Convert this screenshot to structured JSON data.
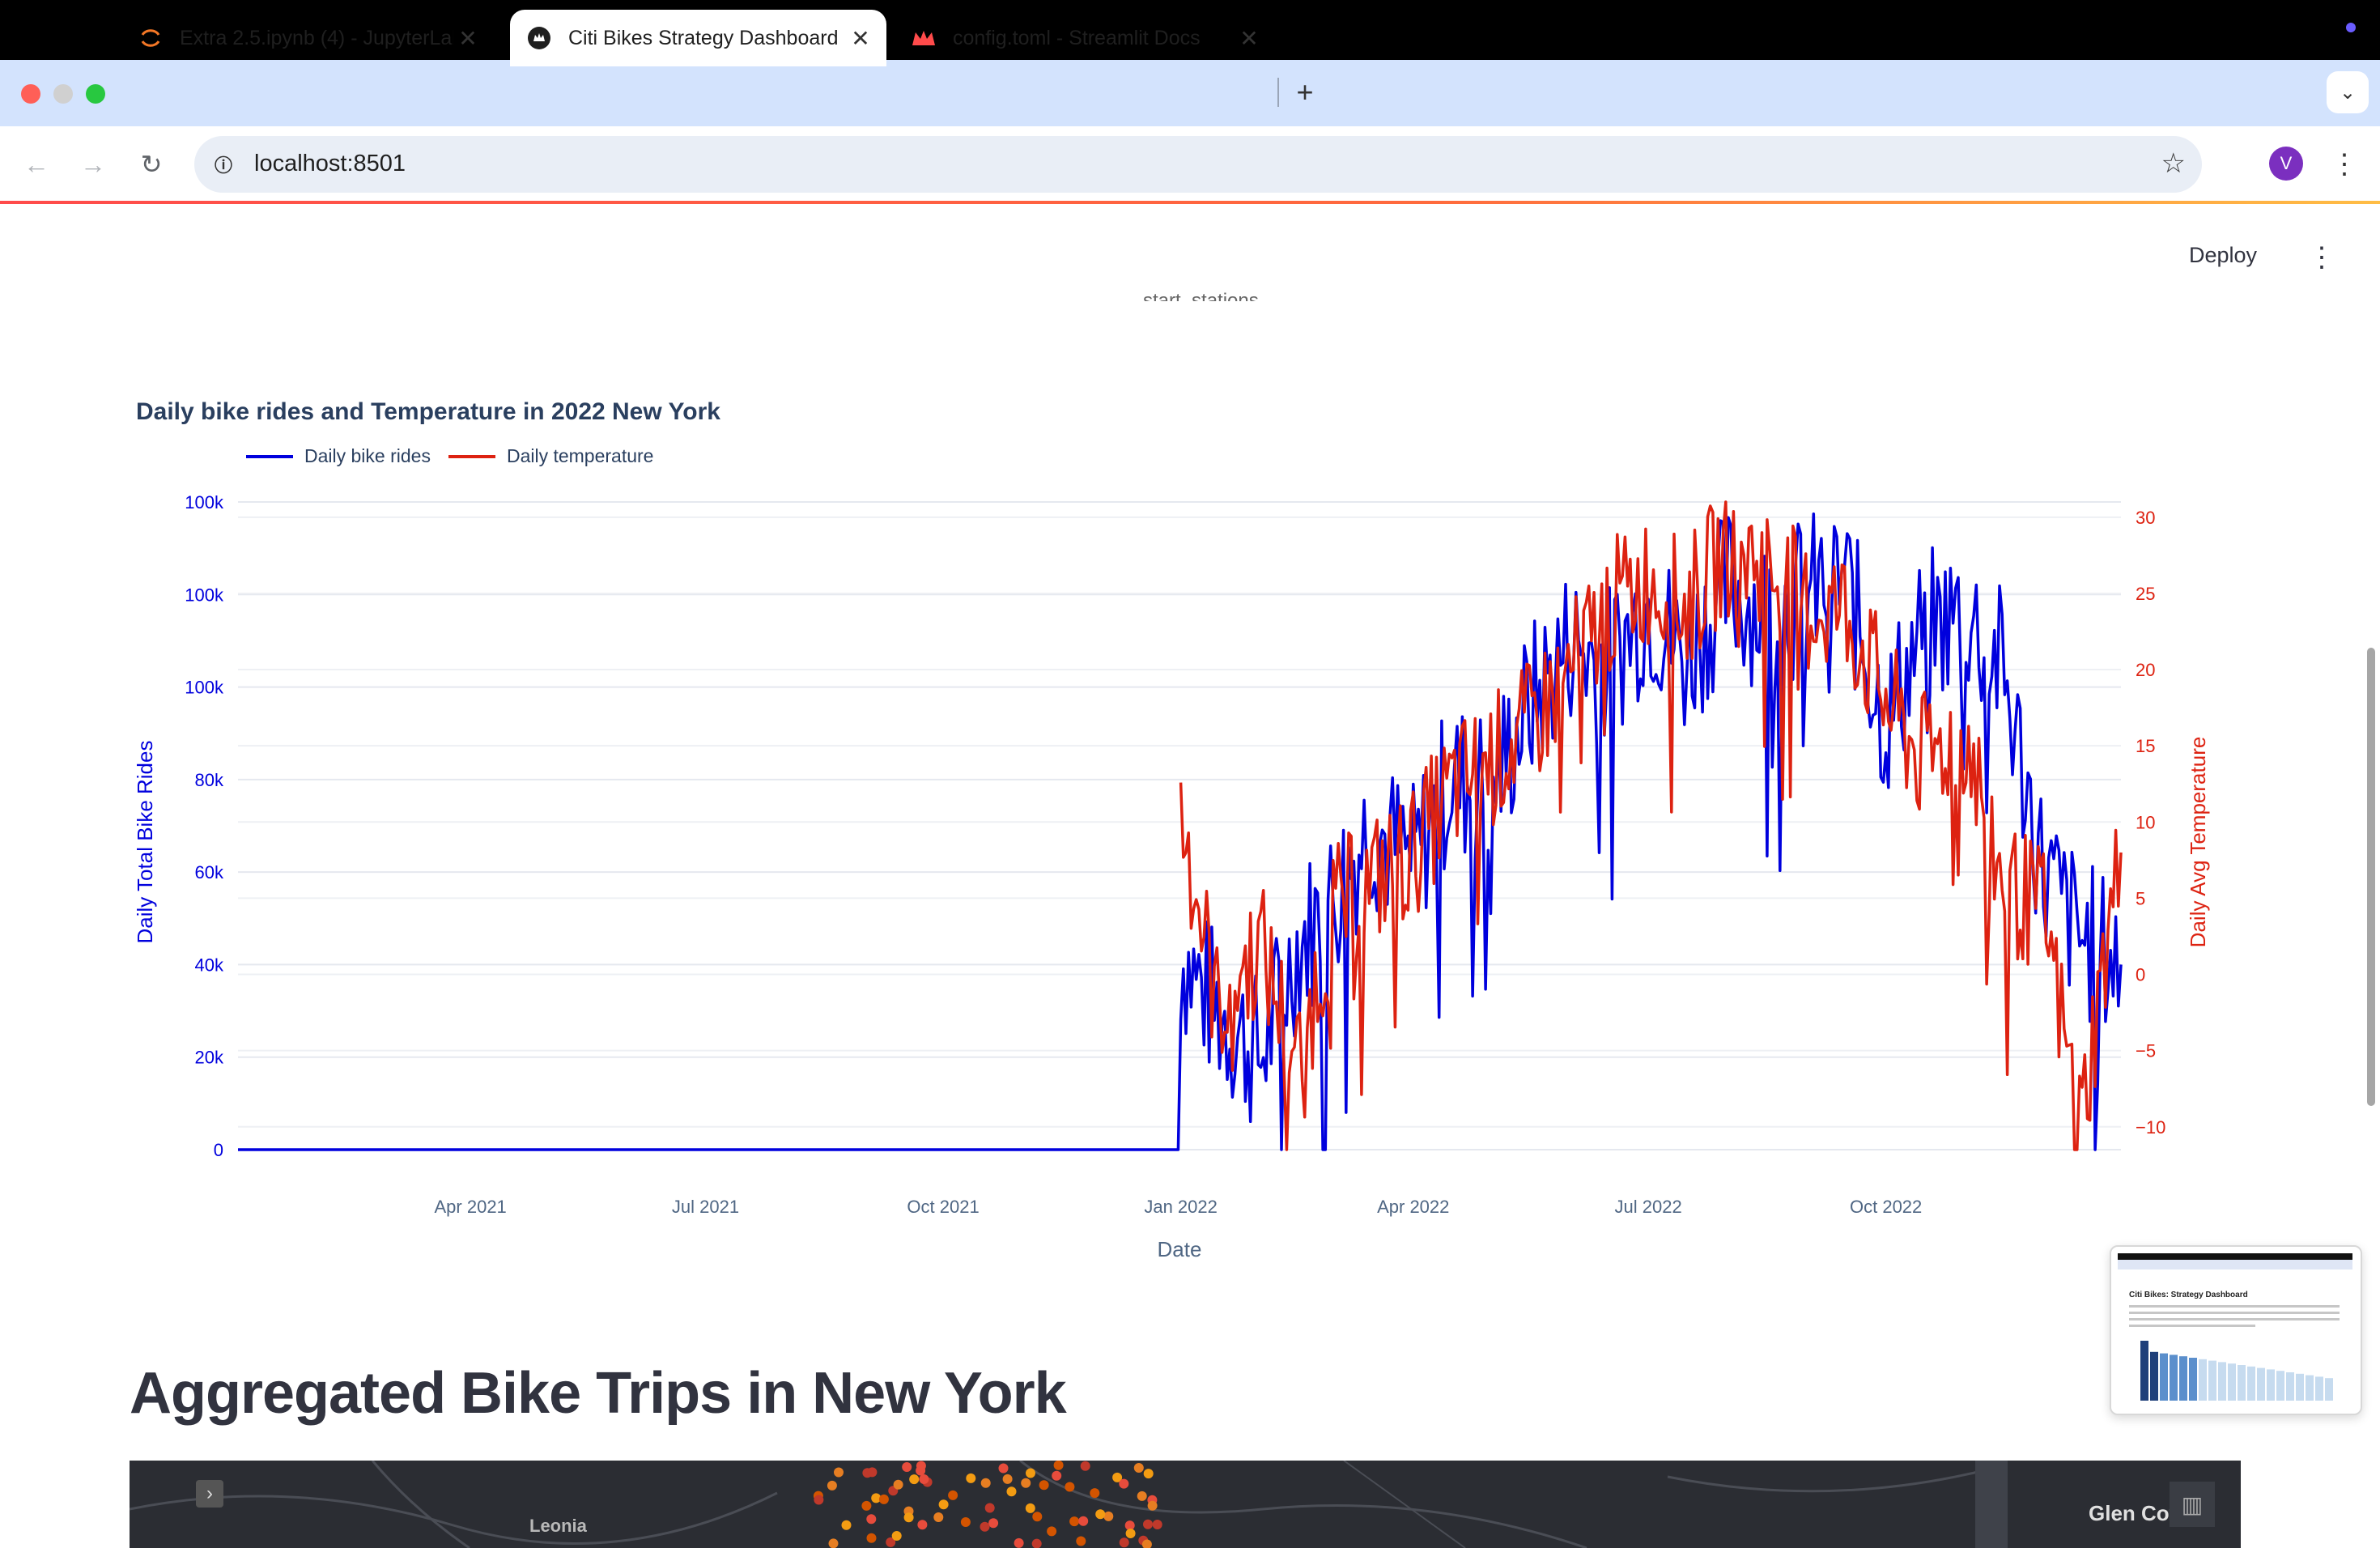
{
  "browser": {
    "tabs": [
      {
        "title": "Extra 2.5.ipynb (4) - JupyterLab",
        "active": false,
        "icon": "jupyter-icon"
      },
      {
        "title": "Citi Bikes Strategy Dashboard",
        "active": true,
        "icon": "streamlit-icon"
      },
      {
        "title": "config.toml - Streamlit Docs",
        "active": false,
        "icon": "streamlit-docs-icon"
      }
    ],
    "url": "localhost:8501",
    "avatar_letter": "V"
  },
  "streamlit": {
    "deploy_label": "Deploy",
    "cut_label": "start_stations"
  },
  "chart_data": {
    "type": "line",
    "title": "Daily bike rides and Temperature in 2022 New York",
    "xlabel": "Date",
    "ylabel": "Daily Total Bike Rides",
    "y2label": "Daily Avg Temperature",
    "x_ticks": [
      "Apr 2021",
      "Jul 2021",
      "Oct 2021",
      "Jan 2022",
      "Apr 2022",
      "Jul 2022",
      "Oct 2022"
    ],
    "y_ticks": [
      "0",
      "20k",
      "40k",
      "60k",
      "80k",
      "100k",
      "100k",
      "100k"
    ],
    "y2_ticks": [
      "−10",
      "−5",
      "0",
      "5",
      "10",
      "15",
      "20",
      "25",
      "30"
    ],
    "ylim": [
      0,
      140000
    ],
    "y2lim": [
      -11.5,
      31
    ],
    "colors": {
      "rides": "#0000dd",
      "temperature": "#dd2211"
    },
    "series": [
      {
        "name": "Daily bike rides",
        "axis": "left",
        "x": [
          "2021-01-01",
          "2021-12-31",
          "2022-01-01",
          "2022-01-15",
          "2022-02-01",
          "2022-02-15",
          "2022-03-01",
          "2022-03-15",
          "2022-04-01",
          "2022-04-15",
          "2022-05-01",
          "2022-05-15",
          "2022-06-01",
          "2022-06-15",
          "2022-07-01",
          "2022-07-15",
          "2022-08-01",
          "2022-08-15",
          "2022-09-01",
          "2022-09-15",
          "2022-10-01",
          "2022-10-15",
          "2022-11-01",
          "2022-11-15",
          "2022-12-01",
          "2022-12-15",
          "2022-12-31"
        ],
        "values": [
          0,
          0,
          42000,
          30000,
          20000,
          44000,
          54000,
          70000,
          62000,
          80000,
          78000,
          95000,
          110000,
          104000,
          118000,
          106000,
          122000,
          116000,
          120000,
          124000,
          92000,
          112000,
          116000,
          104000,
          60000,
          46000,
          40000
        ]
      },
      {
        "name": "Daily temperature",
        "axis": "right",
        "x": [
          "2022-01-01",
          "2022-01-15",
          "2022-02-01",
          "2022-02-15",
          "2022-03-01",
          "2022-03-15",
          "2022-04-01",
          "2022-04-15",
          "2022-05-01",
          "2022-05-15",
          "2022-06-01",
          "2022-06-15",
          "2022-07-01",
          "2022-07-15",
          "2022-08-01",
          "2022-08-15",
          "2022-09-01",
          "2022-09-15",
          "2022-10-01",
          "2022-10-15",
          "2022-11-01",
          "2022-11-15",
          "2022-12-01",
          "2022-12-15",
          "2022-12-31"
        ],
        "values": [
          11,
          -2,
          2,
          -6,
          4,
          6,
          8,
          12,
          14,
          16,
          20,
          24,
          26,
          24,
          28,
          27,
          24,
          24,
          18,
          14,
          16,
          6,
          4,
          -10,
          8
        ]
      }
    ]
  },
  "section": {
    "heading": "Aggregated Bike Trips in New York"
  },
  "map": {
    "labels": [
      "Leonia",
      "Glen Cov"
    ]
  },
  "preview": {
    "title": "Citi Bikes: Strategy Dashboard"
  }
}
